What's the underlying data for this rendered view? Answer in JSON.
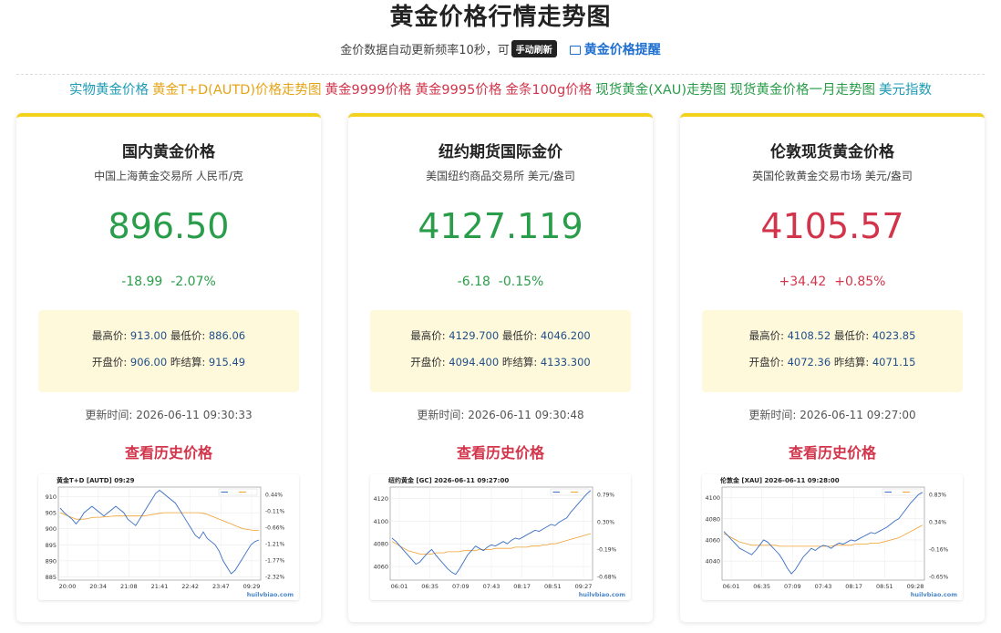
{
  "header": {
    "title": "黄金价格行情走势图",
    "subtitle": "金价数据自动更新频率10秒，可",
    "refresh_button": "手动刷新",
    "remind_link": "黄金价格提醒"
  },
  "links": [
    {
      "label": "实物黄金价格",
      "color": "#1d9bb5"
    },
    {
      "label": "黄金T+D(AUTD)价格走势图",
      "color": "#e6a415"
    },
    {
      "label": "黄金9999价格",
      "color": "#d2354b"
    },
    {
      "label": "黄金9995价格",
      "color": "#d2354b"
    },
    {
      "label": "金条100g价格",
      "color": "#d2354b"
    },
    {
      "label": "现货黄金(XAU)走势图",
      "color": "#2a9d4a"
    },
    {
      "label": "现货黄金价格一月走势图",
      "color": "#2a9d4a"
    },
    {
      "label": "美元指数",
      "color": "#1d9bb5"
    }
  ],
  "cards": [
    {
      "title": "国内黄金价格",
      "source": "中国上海黄金交易所 人民币/克",
      "price": "896.50",
      "change": "-18.99",
      "change_pct": "-2.07%",
      "direction": "down",
      "high_label": "最高价:",
      "high": "913.00",
      "low_label": "最低价:",
      "low": "886.06",
      "open_label": "开盘价:",
      "open": "906.00",
      "prev_label": "昨结算:",
      "prev": "915.49",
      "updated_label": "更新时间:",
      "updated": "2026-06-11 09:30:33",
      "history_link": "查看历史价格"
    },
    {
      "title": "纽约期货国际金价",
      "source": "美国纽约商品交易所 美元/盎司",
      "price": "4127.119",
      "change": "-6.18",
      "change_pct": "-0.15%",
      "direction": "down",
      "high_label": "最高价:",
      "high": "4129.700",
      "low_label": "最低价:",
      "low": "4046.200",
      "open_label": "开盘价:",
      "open": "4094.400",
      "prev_label": "昨结算:",
      "prev": "4133.300",
      "updated_label": "更新时间:",
      "updated": "2026-06-11 09:30:48",
      "history_link": "查看历史价格"
    },
    {
      "title": "伦敦现货黄金价格",
      "source": "英国伦敦黄金交易市场 美元/盎司",
      "price": "4105.57",
      "change": "+34.42",
      "change_pct": "+0.85%",
      "direction": "up",
      "high_label": "最高价:",
      "high": "4108.52",
      "low_label": "最低价:",
      "low": "4023.85",
      "open_label": "开盘价:",
      "open": "4072.36",
      "prev_label": "昨结算:",
      "prev": "4071.15",
      "updated_label": "更新时间:",
      "updated": "2026-06-11 09:27:00",
      "history_link": "查看历史价格"
    }
  ],
  "chart_data": [
    {
      "type": "line",
      "title": "黄金T+D [AUTD]  09:29",
      "watermark": "huilvbiao.com",
      "x_ticks": [
        "20:00",
        "20:34",
        "21:08",
        "21:41",
        "22:42",
        "23:47",
        "09:29"
      ],
      "y_ticks": [
        910,
        905,
        900,
        895,
        890,
        885
      ],
      "right_ticks": [
        "0.44%",
        "-0.11%",
        "-0.66%",
        "-1.21%",
        "-1.77%",
        "-2.32%"
      ],
      "ylim": [
        884,
        913
      ],
      "series": [
        {
          "values": [
            906.5,
            905,
            904,
            903,
            901.5,
            903,
            905,
            906,
            907,
            906,
            905,
            904,
            905,
            906,
            907,
            906,
            905,
            903,
            902,
            901,
            903,
            905,
            907,
            909,
            911,
            912,
            911,
            910,
            909,
            908,
            906,
            904,
            902,
            900,
            898,
            897,
            899,
            897,
            896,
            895,
            893,
            890,
            888,
            886,
            887,
            889,
            891,
            893,
            895,
            896,
            896.5
          ],
          "color": "#3a6fc4"
        },
        {
          "values": [
            905,
            904.5,
            904,
            903.5,
            903,
            903,
            903,
            903.2,
            903.5,
            903.6,
            903.6,
            903.7,
            903.8,
            903.9,
            904,
            904,
            904,
            904,
            904,
            904,
            904,
            904,
            904.2,
            904.4,
            904.6,
            904.8,
            905,
            905,
            905,
            905,
            905,
            905,
            905,
            905,
            905,
            905,
            904.8,
            904.5,
            904,
            903.5,
            903,
            902.5,
            902,
            901.5,
            901,
            900.5,
            900,
            899.8,
            899.6,
            899.5,
            899.5
          ],
          "color": "#f0a030"
        }
      ]
    },
    {
      "type": "line",
      "title": "纽约黄金 [GC]  2026-06-11 09:27:00",
      "watermark": "huilvbiao.com",
      "x_ticks": [
        "06:01",
        "06:35",
        "07:09",
        "07:43",
        "08:17",
        "08:51",
        "09:27"
      ],
      "y_ticks": [
        4120,
        4100,
        4080,
        4060
      ],
      "right_ticks": [
        "0.79%",
        "0.30%",
        "-0.19%",
        "-0.68%"
      ],
      "ylim": [
        4048,
        4130
      ],
      "series": [
        {
          "values": [
            4085,
            4082,
            4078,
            4074,
            4070,
            4066,
            4062,
            4064,
            4068,
            4072,
            4075,
            4070,
            4066,
            4062,
            4058,
            4055,
            4053,
            4058,
            4064,
            4070,
            4074,
            4078,
            4076,
            4074,
            4077,
            4079,
            4078,
            4080,
            4082,
            4080,
            4083,
            4085,
            4084,
            4086,
            4088,
            4090,
            4092,
            4091,
            4093,
            4095,
            4097,
            4096,
            4099,
            4101,
            4103,
            4108,
            4112,
            4116,
            4120,
            4124,
            4127
          ],
          "color": "#3a6fc4"
        },
        {
          "values": [
            4082,
            4080,
            4078,
            4076,
            4074,
            4073,
            4072,
            4071,
            4071,
            4071,
            4071,
            4072,
            4072,
            4072,
            4073,
            4073,
            4073,
            4073,
            4074,
            4074,
            4074,
            4074,
            4075,
            4075,
            4075,
            4075,
            4076,
            4076,
            4076,
            4076,
            4076,
            4077,
            4077,
            4077,
            4077,
            4078,
            4078,
            4078,
            4079,
            4079,
            4080,
            4080,
            4081,
            4082,
            4083,
            4084,
            4085,
            4086,
            4087,
            4088,
            4089
          ],
          "color": "#f0a030"
        }
      ]
    },
    {
      "type": "line",
      "title": "伦敦金 [XAU]  2026-06-11 09:28:00",
      "watermark": "huilvbiao.com",
      "x_ticks": [
        "06:01",
        "06:35",
        "07:09",
        "07:43",
        "08:17",
        "08:51",
        "09:28"
      ],
      "y_ticks": [
        4100,
        4080,
        4060,
        4040
      ],
      "right_ticks": [
        "0.83%",
        "0.34%",
        "-0.16%",
        "-0.65%"
      ],
      "ylim": [
        4022,
        4110
      ],
      "series": [
        {
          "values": [
            4068,
            4064,
            4060,
            4056,
            4052,
            4050,
            4048,
            4046,
            4050,
            4055,
            4060,
            4058,
            4054,
            4050,
            4046,
            4040,
            4033,
            4028,
            4032,
            4038,
            4044,
            4048,
            4052,
            4050,
            4053,
            4055,
            4054,
            4052,
            4055,
            4057,
            4056,
            4058,
            4060,
            4059,
            4061,
            4063,
            4065,
            4067,
            4066,
            4068,
            4070,
            4072,
            4075,
            4078,
            4080,
            4085,
            4090,
            4095,
            4099,
            4103,
            4105
          ],
          "color": "#3a6fc4"
        },
        {
          "values": [
            4066,
            4064,
            4062,
            4060,
            4058,
            4057,
            4056,
            4055,
            4055,
            4055,
            4055,
            4055,
            4055,
            4055,
            4054,
            4054,
            4054,
            4054,
            4054,
            4054,
            4054,
            4054,
            4054,
            4054,
            4054,
            4054,
            4054,
            4054,
            4055,
            4055,
            4055,
            4055,
            4055,
            4056,
            4056,
            4056,
            4056,
            4057,
            4057,
            4057,
            4058,
            4059,
            4060,
            4061,
            4062,
            4064,
            4066,
            4068,
            4070,
            4072,
            4074
          ],
          "color": "#f0a030"
        }
      ]
    }
  ]
}
